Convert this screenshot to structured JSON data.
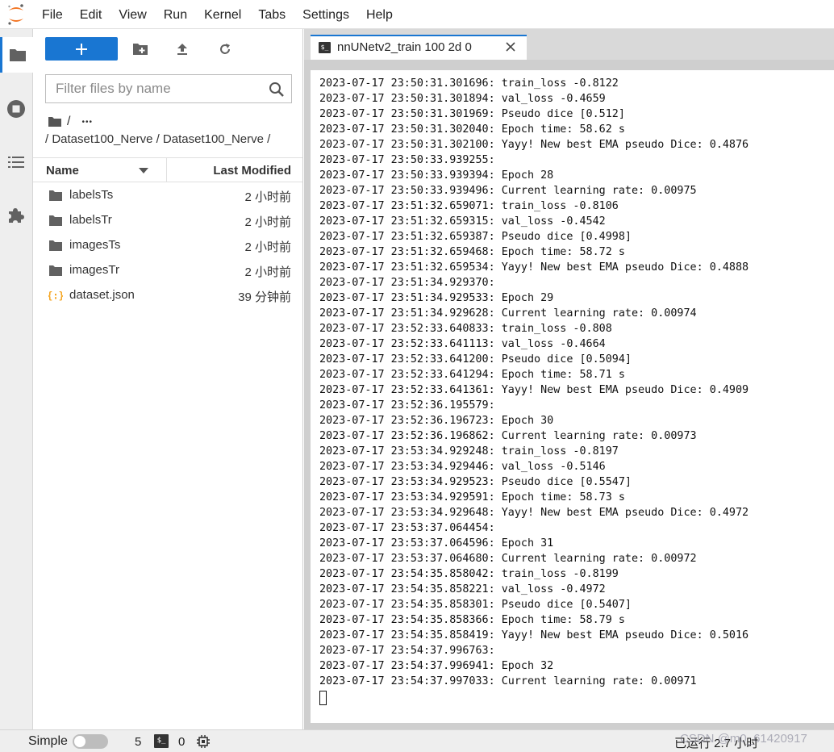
{
  "menubar": {
    "items": [
      "File",
      "Edit",
      "View",
      "Run",
      "Kernel",
      "Tabs",
      "Settings",
      "Help"
    ]
  },
  "activity_bar": {
    "icons": [
      "folder-icon",
      "running-icon",
      "toc-icon",
      "extension-icon"
    ]
  },
  "file_browser": {
    "new_button_label": "+",
    "filter_placeholder": "Filter files by name",
    "breadcrumb_root": "/",
    "breadcrumb_ellipsis": "•••",
    "breadcrumb_path": "/ Dataset100_Nerve / Dataset100_Nerve /",
    "columns": {
      "name": "Name",
      "last_modified": "Last Modified"
    },
    "files": [
      {
        "name": "labelsTs",
        "type": "folder",
        "modified": "2 小时前"
      },
      {
        "name": "labelsTr",
        "type": "folder",
        "modified": "2 小时前"
      },
      {
        "name": "imagesTs",
        "type": "folder",
        "modified": "2 小时前"
      },
      {
        "name": "imagesTr",
        "type": "folder",
        "modified": "2 小时前"
      },
      {
        "name": "dataset.json",
        "type": "json",
        "modified": "39 分钟前"
      }
    ]
  },
  "tab": {
    "icon_text": "$_",
    "title": "nnUNetv2_train 100 2d 0"
  },
  "terminal": {
    "lines": [
      "2023-07-17 23:50:31.301696: train_loss -0.8122",
      "2023-07-17 23:50:31.301894: val_loss -0.4659",
      "2023-07-17 23:50:31.301969: Pseudo dice [0.512]",
      "2023-07-17 23:50:31.302040: Epoch time: 58.62 s",
      "2023-07-17 23:50:31.302100: Yayy! New best EMA pseudo Dice: 0.4876",
      "2023-07-17 23:50:33.939255:",
      "2023-07-17 23:50:33.939394: Epoch 28",
      "2023-07-17 23:50:33.939496: Current learning rate: 0.00975",
      "2023-07-17 23:51:32.659071: train_loss -0.8106",
      "2023-07-17 23:51:32.659315: val_loss -0.4542",
      "2023-07-17 23:51:32.659387: Pseudo dice [0.4998]",
      "2023-07-17 23:51:32.659468: Epoch time: 58.72 s",
      "2023-07-17 23:51:32.659534: Yayy! New best EMA pseudo Dice: 0.4888",
      "2023-07-17 23:51:34.929370:",
      "2023-07-17 23:51:34.929533: Epoch 29",
      "2023-07-17 23:51:34.929628: Current learning rate: 0.00974",
      "2023-07-17 23:52:33.640833: train_loss -0.808",
      "2023-07-17 23:52:33.641113: val_loss -0.4664",
      "2023-07-17 23:52:33.641200: Pseudo dice [0.5094]",
      "2023-07-17 23:52:33.641294: Epoch time: 58.71 s",
      "2023-07-17 23:52:33.641361: Yayy! New best EMA pseudo Dice: 0.4909",
      "2023-07-17 23:52:36.195579:",
      "2023-07-17 23:52:36.196723: Epoch 30",
      "2023-07-17 23:52:36.196862: Current learning rate: 0.00973",
      "2023-07-17 23:53:34.929248: train_loss -0.8197",
      "2023-07-17 23:53:34.929446: val_loss -0.5146",
      "2023-07-17 23:53:34.929523: Pseudo dice [0.5547]",
      "2023-07-17 23:53:34.929591: Epoch time: 58.73 s",
      "2023-07-17 23:53:34.929648: Yayy! New best EMA pseudo Dice: 0.4972",
      "2023-07-17 23:53:37.064454:",
      "2023-07-17 23:53:37.064596: Epoch 31",
      "2023-07-17 23:53:37.064680: Current learning rate: 0.00972",
      "2023-07-17 23:54:35.858042: train_loss -0.8199",
      "2023-07-17 23:54:35.858221: val_loss -0.4972",
      "2023-07-17 23:54:35.858301: Pseudo dice [0.5407]",
      "2023-07-17 23:54:35.858366: Epoch time: 58.79 s",
      "2023-07-17 23:54:35.858419: Yayy! New best EMA pseudo Dice: 0.5016",
      "2023-07-17 23:54:37.996763:",
      "2023-07-17 23:54:37.996941: Epoch 32",
      "2023-07-17 23:54:37.997033: Current learning rate: 0.00971"
    ]
  },
  "statusbar": {
    "simple_label": "Simple",
    "simple_mode_on": false,
    "kernel_count": "5",
    "terminal_icon_text": "$_",
    "terminal_count": "0",
    "running_time": "已运行 2.7 小时",
    "watermark": "CSDN @m0_61420917"
  },
  "colors": {
    "accent": "#1976d2",
    "logo_orange": "#f37726"
  }
}
